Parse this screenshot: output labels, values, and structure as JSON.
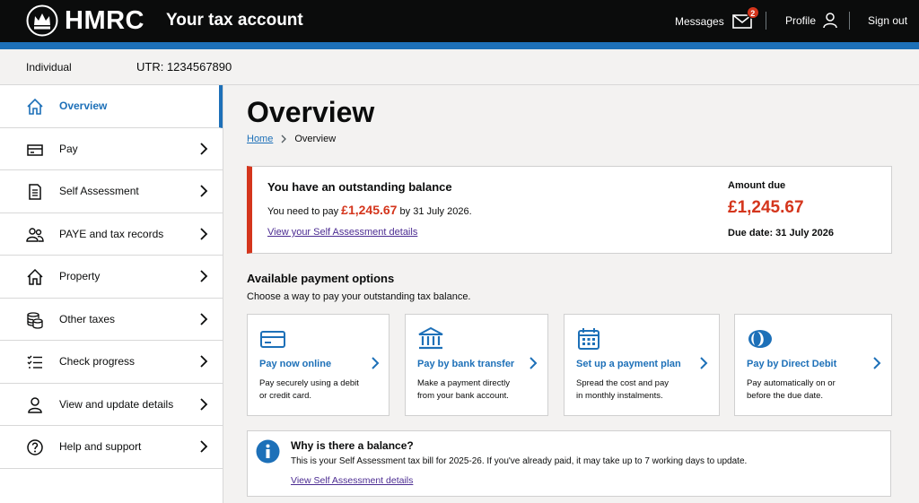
{
  "header": {
    "logo_text": "HMRC",
    "app_title": "Your tax account",
    "messages_label": "Messages",
    "messages_count": "2",
    "profile_label": "Profile",
    "signout_label": "Sign out"
  },
  "identity": {
    "type": "Individual",
    "utr": "UTR: 1234567890"
  },
  "sidebar": {
    "items": [
      {
        "label": "Overview",
        "icon": "home-icon",
        "active": true
      },
      {
        "label": "Pay",
        "icon": "card-icon"
      },
      {
        "label": "Self Assessment",
        "icon": "document-icon"
      },
      {
        "label": "PAYE and tax records",
        "icon": "people-icon"
      },
      {
        "label": "Property",
        "icon": "house-icon"
      },
      {
        "label": "Other taxes",
        "icon": "coins-icon"
      },
      {
        "label": "Check progress",
        "icon": "checklist-icon"
      },
      {
        "label": "View and update details",
        "icon": "person-icon"
      },
      {
        "label": "Help and support",
        "icon": "help-icon"
      }
    ]
  },
  "page": {
    "title": "Overview",
    "breadcrumb": {
      "home": "Home",
      "current": "Overview"
    }
  },
  "balance": {
    "title": "You have an outstanding balance",
    "desc_prefix": "You need to pay ",
    "amount": "£1,245.67",
    "desc_suffix": " by 31 July 2026.",
    "link": "View your Self Assessment details",
    "amount_due_label": "Amount due",
    "amount_due": "£1,245.67",
    "due_date": "Due date: 31 July 2026"
  },
  "payment": {
    "heading": "Available payment options",
    "subheading": "Choose a way to pay your outstanding tax balance.",
    "options": [
      {
        "title": "Pay now online",
        "line1": "Pay securely using a debit",
        "line2": "or credit card.",
        "icon": "credit-card-icon"
      },
      {
        "title": "Pay by bank transfer",
        "line1": "Make a payment directly",
        "line2": "from your bank account.",
        "icon": "bank-icon"
      },
      {
        "title": "Set up a payment plan",
        "line1": "Spread the cost and pay",
        "line2": "in monthly instalments.",
        "icon": "calendar-icon"
      },
      {
        "title": "Pay by Direct Debit",
        "line1": "Pay automatically on or",
        "line2": "before the due date.",
        "icon": "direct-debit-icon"
      }
    ]
  },
  "info": {
    "title": "Why is there a balance?",
    "desc": "This is your Self Assessment tax bill for 2025-26. If you've already paid, it may take up to 7 working days to update.",
    "link": "View Self Assessment details"
  },
  "colors": {
    "brand_blue": "#1d70b8",
    "alert_red": "#d4351c",
    "link_purple": "#4c2c92",
    "header_black": "#0b0c0c"
  }
}
